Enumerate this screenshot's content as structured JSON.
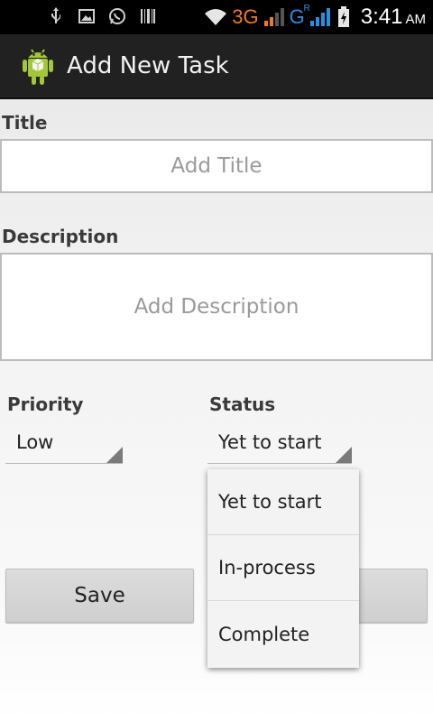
{
  "status_bar": {
    "network_3g": "3G",
    "network_g": "G",
    "network_g_sup": "R",
    "time": "3:41",
    "ampm": "AM",
    "icons": [
      "usb-icon",
      "image-icon",
      "whatsapp-icon",
      "barcode-icon",
      "wifi-icon",
      "signal-icon",
      "battery-icon"
    ]
  },
  "action_bar": {
    "title": "Add New Task",
    "app_icon": "android-icon"
  },
  "form": {
    "title_label": "Title",
    "title_placeholder": "Add Title",
    "description_label": "Description",
    "description_placeholder": "Add Description",
    "priority_label": "Priority",
    "priority_value": "Low",
    "status_label": "Status",
    "status_value": "Yet to start"
  },
  "buttons": {
    "save": "Save"
  },
  "status_dropdown": {
    "options": [
      "Yet to start",
      "In-process",
      "Complete"
    ]
  }
}
